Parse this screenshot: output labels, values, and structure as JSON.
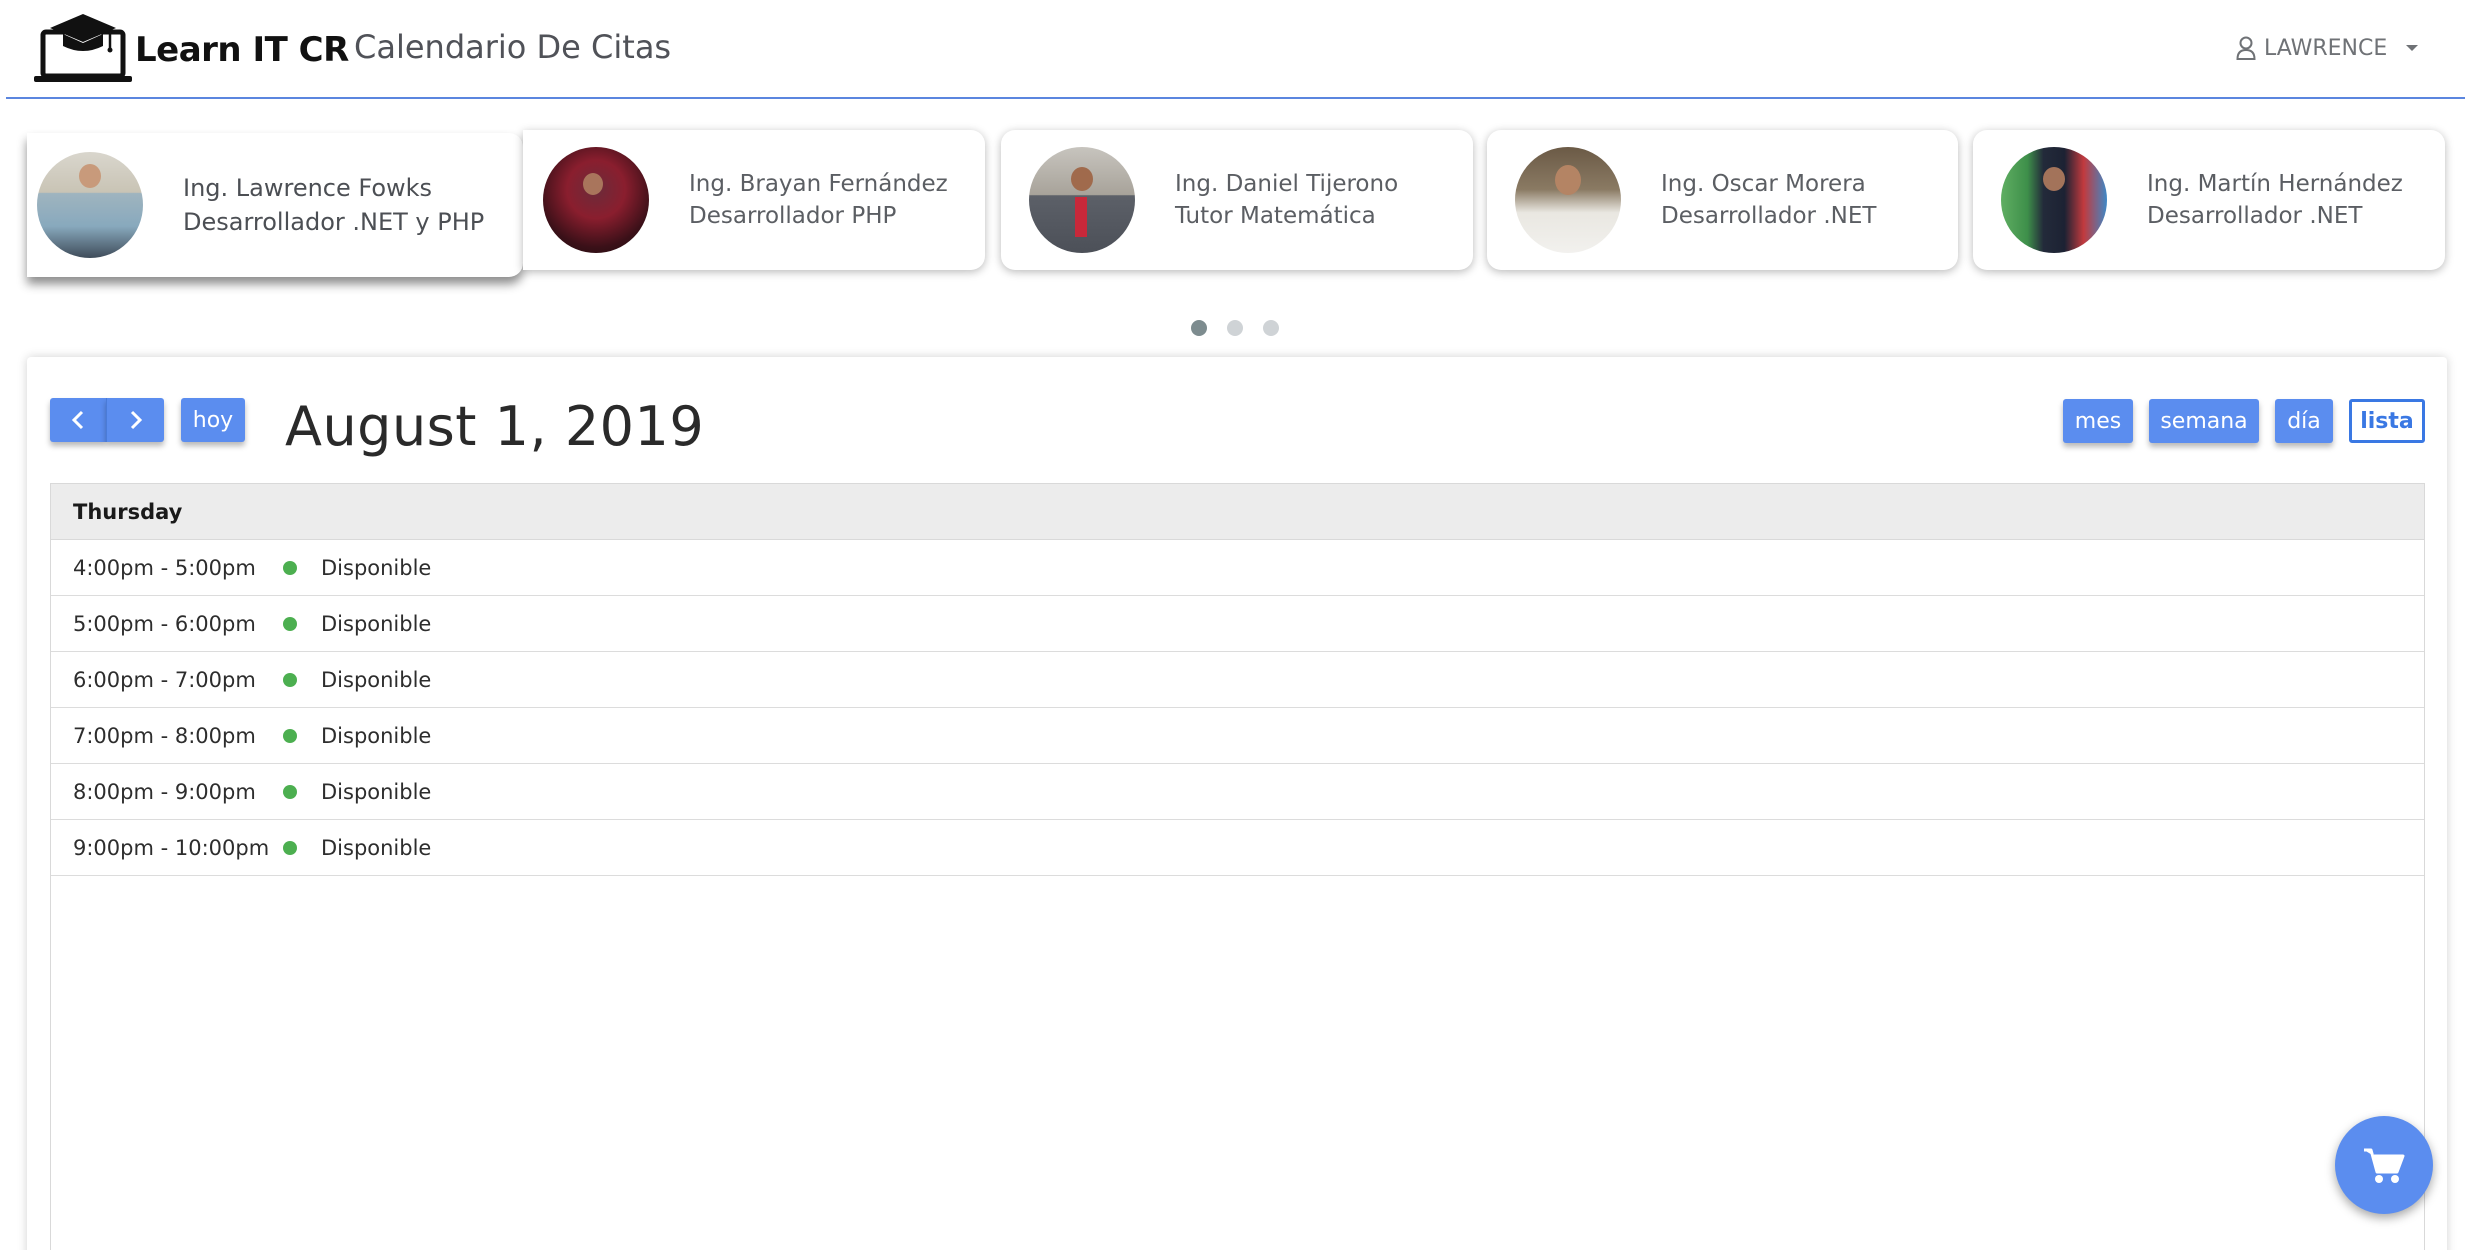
{
  "header": {
    "brand": "Learn IT CR",
    "title": "Calendario De Citas",
    "user": "LAWRENCE"
  },
  "tutors": [
    {
      "name": "Ing. Lawrence Fowks",
      "role": "Desarrollador .NET y PHP",
      "active": true
    },
    {
      "name": "Ing. Brayan Fernández",
      "role": "Desarrollador PHP",
      "active": false
    },
    {
      "name": "Ing. Daniel Tijerono",
      "role": "Tutor Matemática",
      "active": false
    },
    {
      "name": "Ing. Oscar Morera",
      "role": "Desarrollador .NET",
      "active": false
    },
    {
      "name": "Ing. Martín Hernández",
      "role": "Desarrollador .NET",
      "active": false
    }
  ],
  "carousel": {
    "page_count": 3,
    "active_page": 1
  },
  "calendar": {
    "title": "August 1, 2019",
    "today_label": "hoy",
    "views": [
      "mes",
      "semana",
      "día",
      "lista"
    ],
    "active_view": "lista",
    "day_label": "Thursday",
    "events": [
      {
        "time": "4:00pm - 5:00pm",
        "title": "Disponible"
      },
      {
        "time": "5:00pm - 6:00pm",
        "title": "Disponible"
      },
      {
        "time": "6:00pm - 7:00pm",
        "title": "Disponible"
      },
      {
        "time": "7:00pm - 8:00pm",
        "title": "Disponible"
      },
      {
        "time": "8:00pm - 9:00pm",
        "title": "Disponible"
      },
      {
        "time": "9:00pm - 10:00pm",
        "title": "Disponible"
      }
    ]
  },
  "colors": {
    "accent": "#5b8def",
    "header_rule": "#5b86df",
    "event_dot": "#4caf50",
    "active_view_text": "#3a78e3"
  },
  "icons": {
    "logo": "laptop-graduation-cap-icon",
    "user": "user-icon",
    "dropdown": "caret-down-icon",
    "prev": "chevron-left-icon",
    "next": "chevron-right-icon",
    "cart": "shopping-cart-icon"
  }
}
